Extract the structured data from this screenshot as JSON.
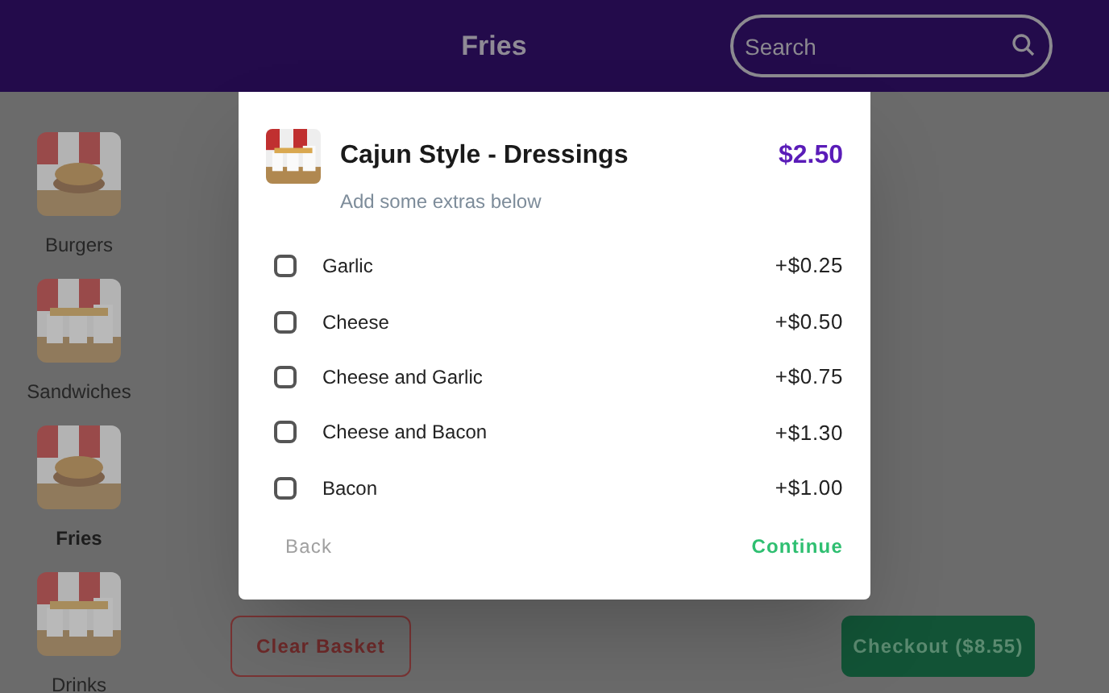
{
  "header": {
    "title": "Fries",
    "search": {
      "placeholder": "Search"
    }
  },
  "categories": [
    {
      "label": "Burgers",
      "selected": false
    },
    {
      "label": "Sandwiches",
      "selected": false
    },
    {
      "label": "Fries",
      "selected": true
    },
    {
      "label": "Drinks",
      "selected": false
    }
  ],
  "modal": {
    "title": "Cajun Style - Dressings",
    "price": "$2.50",
    "subtitle": "Add some extras below",
    "extras": [
      {
        "label": "Garlic",
        "price": "+$0.25",
        "checked": false
      },
      {
        "label": "Cheese",
        "price": "+$0.50",
        "checked": false
      },
      {
        "label": "Cheese and Garlic",
        "price": "+$0.75",
        "checked": false
      },
      {
        "label": "Cheese and Bacon",
        "price": "+$1.30",
        "checked": false
      },
      {
        "label": "Bacon",
        "price": "+$1.00",
        "checked": false
      }
    ],
    "back": "Back",
    "continue": "Continue"
  },
  "basket": {
    "clear": "Clear Basket",
    "checkout": "Checkout ($8.55)"
  }
}
